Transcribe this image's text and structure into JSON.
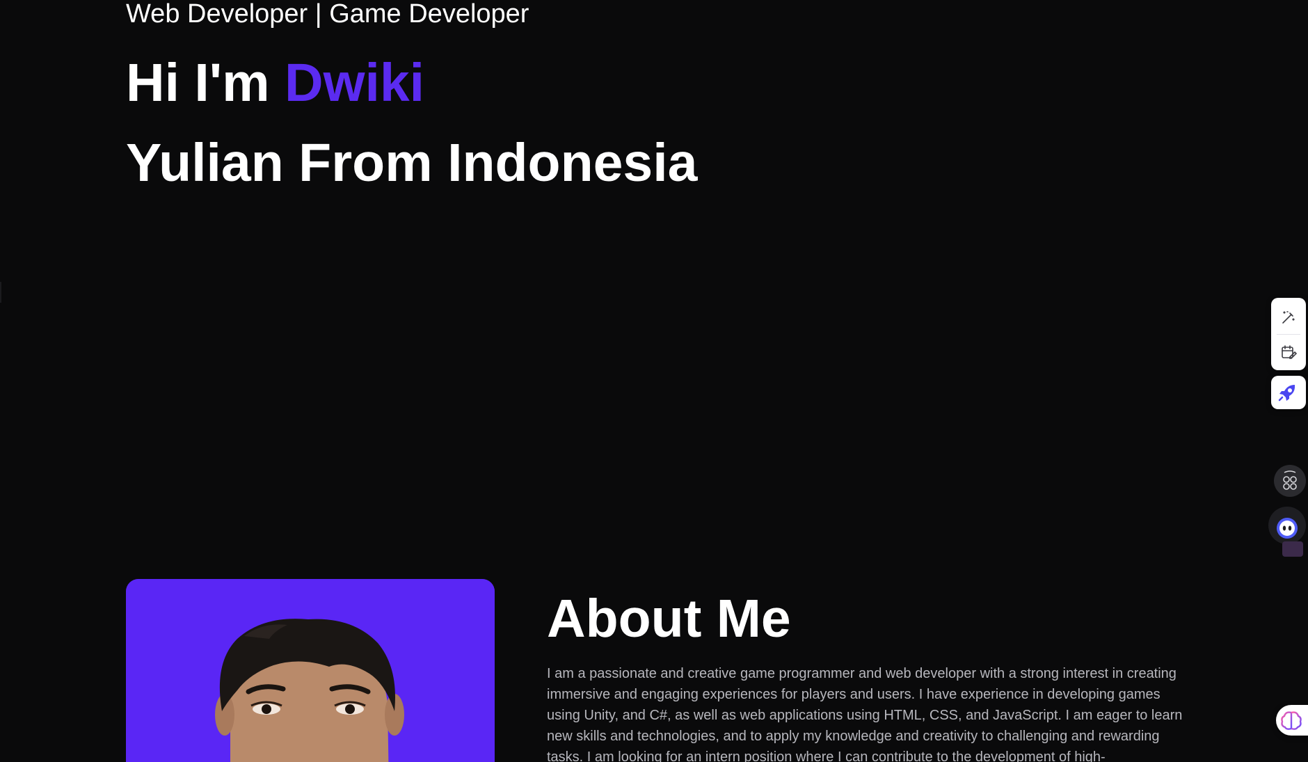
{
  "hero": {
    "subtitle": "Web Developer | Game Developer",
    "greeting_prefix": "Hi I'm ",
    "greeting_name": "Dwiki",
    "greeting_line2": "Yulian From Indonesia"
  },
  "about": {
    "title": "About Me",
    "text": "I am a passionate and creative game programmer and web developer with a strong interest in creating immersive and engaging experiences for players and users. I have experience in developing games using Unity, and C#, as well as web applications using HTML, CSS, and JavaScript. I am eager to learn new skills and technologies, and to apply my knowledge and creativity to challenging and rewarding tasks. I am looking for an intern position where I can contribute to the development of high-"
  },
  "widgets": {
    "tools": [
      {
        "icon": "magic-edit-icon"
      },
      {
        "icon": "calendar-edit-icon"
      }
    ],
    "rocket": {
      "icon": "rocket-icon"
    },
    "apps": {
      "icon": "apps-grid-icon"
    },
    "assistant": {
      "icon": "assistant-face-icon"
    },
    "brain": {
      "icon": "brain-icon"
    }
  },
  "colors": {
    "background": "#0a0a0b",
    "accent": "#5b2bf0",
    "photo_background": "#5a26f5",
    "body_text": "#b7b7bd"
  }
}
